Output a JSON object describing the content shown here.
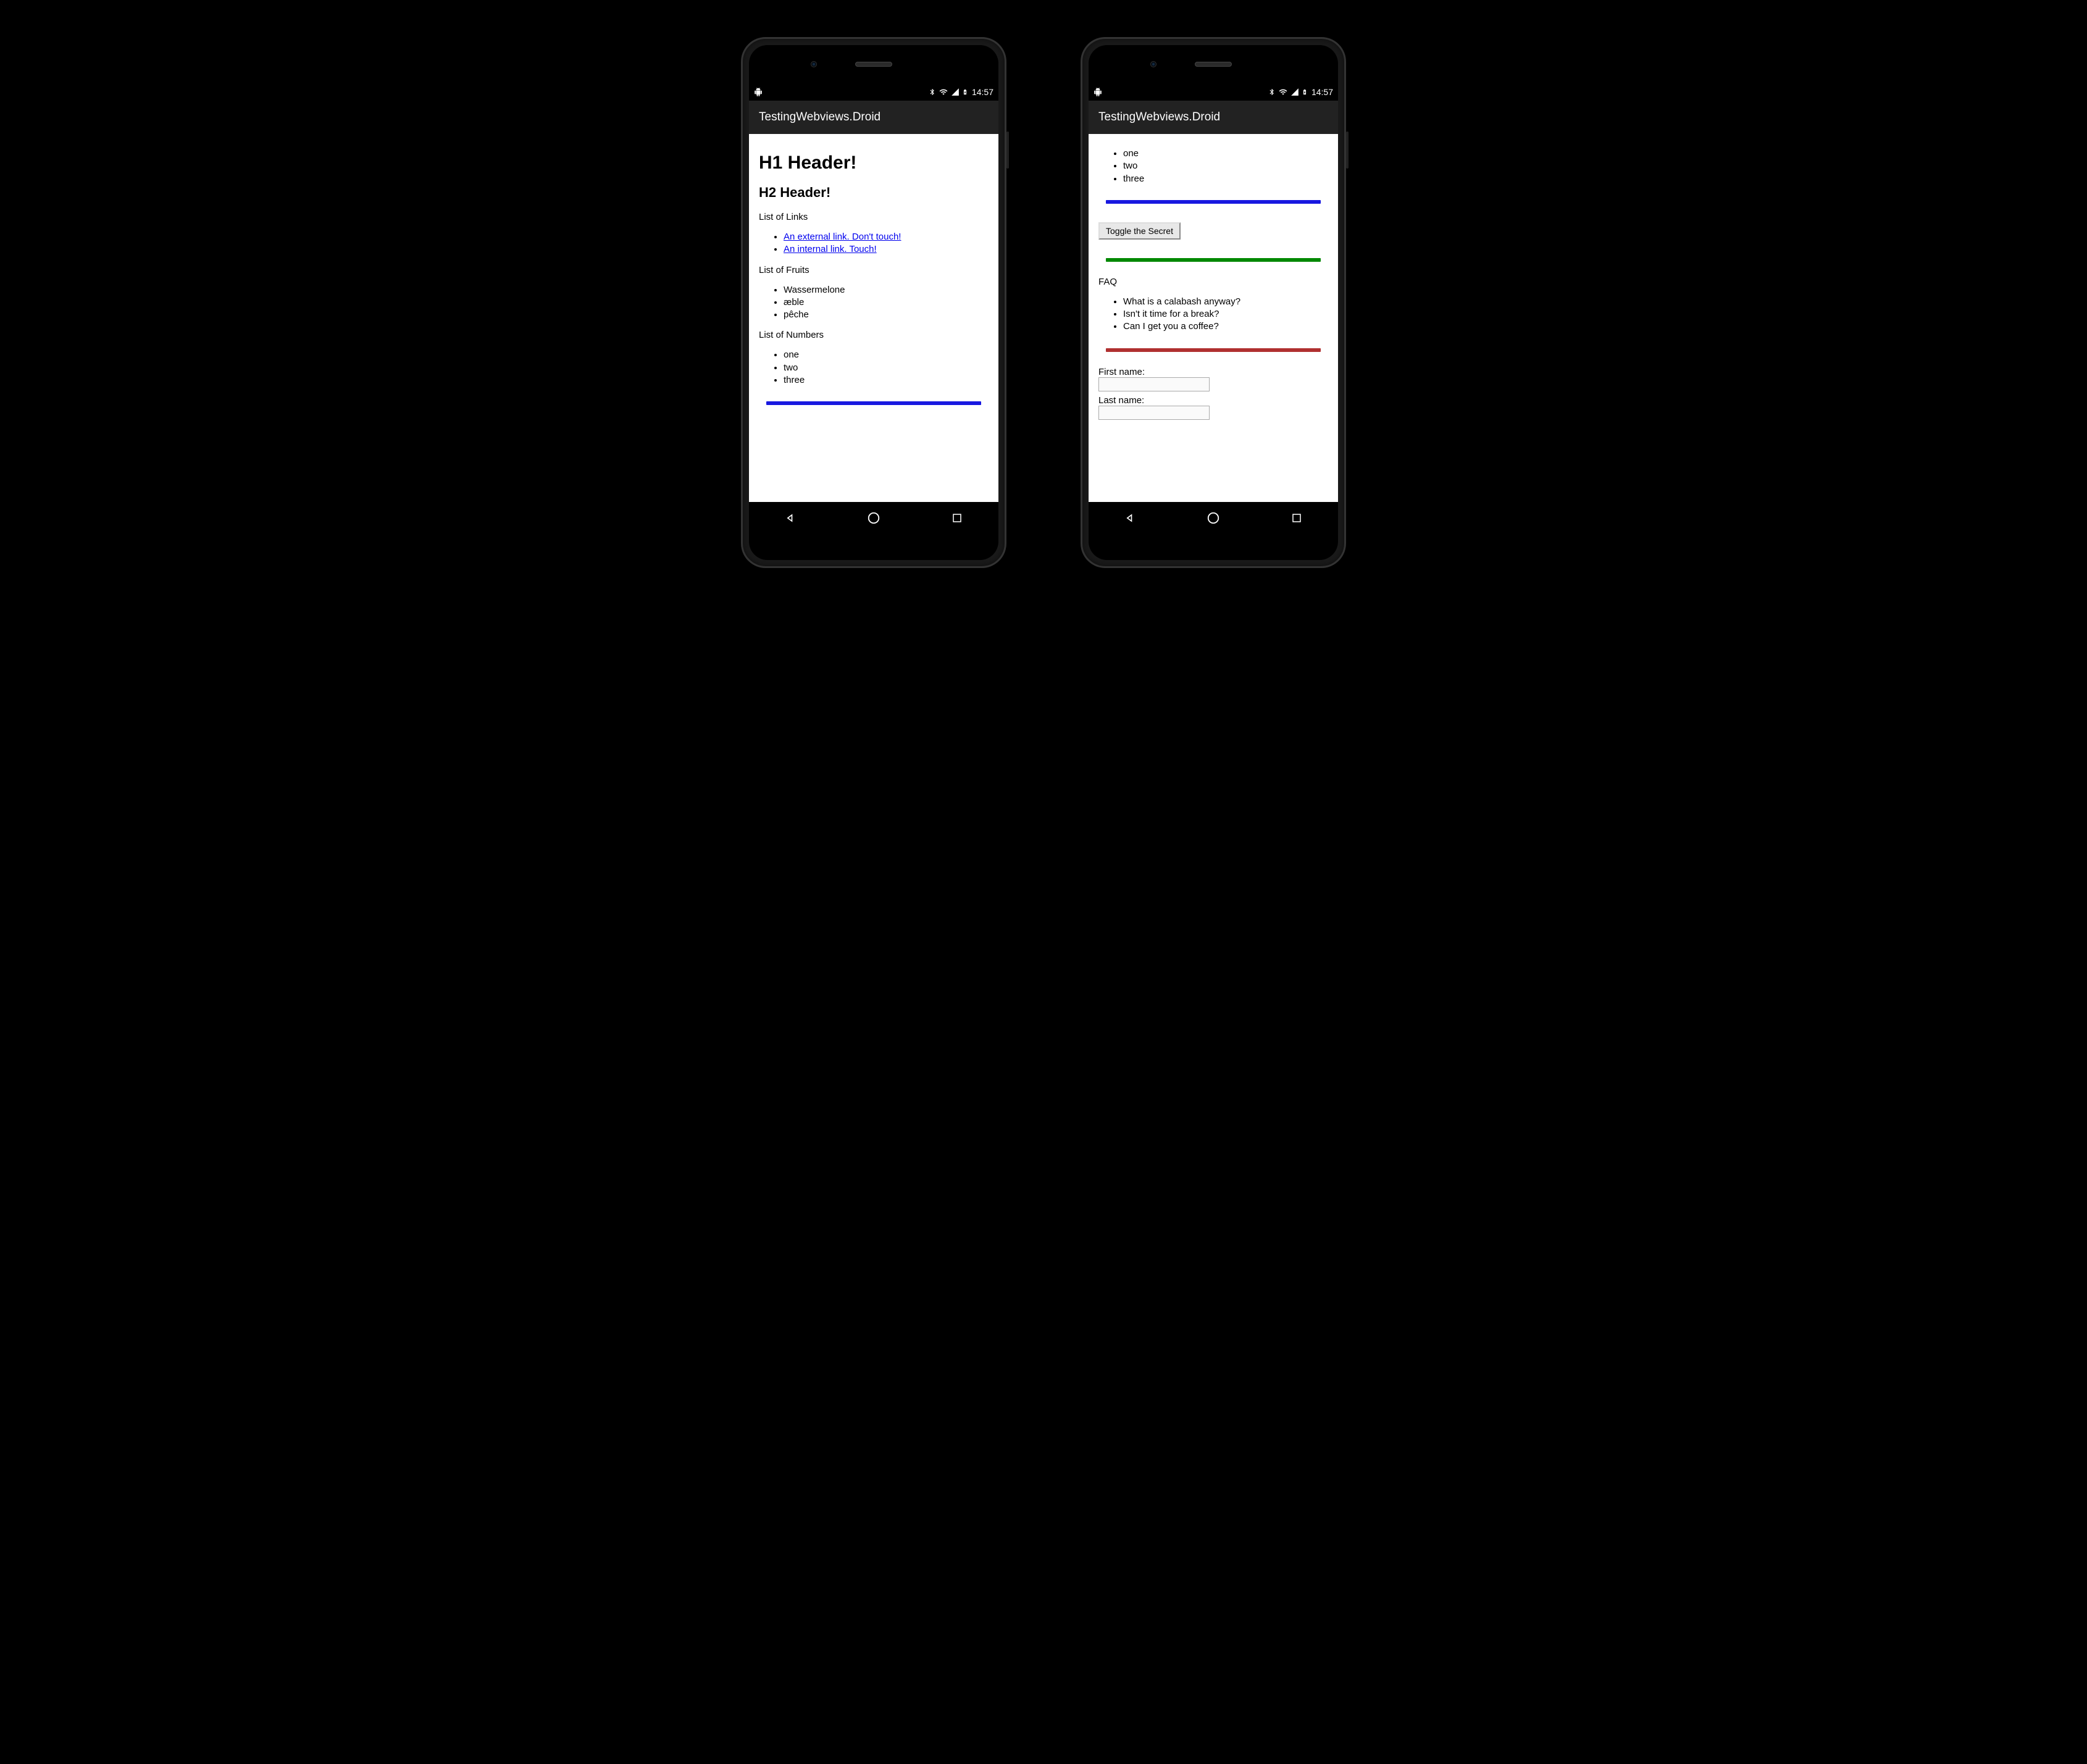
{
  "status_bar": {
    "time": "14:57"
  },
  "app_bar": {
    "title": "TestingWebviews.Droid"
  },
  "phone1": {
    "h1": "H1 Header!",
    "h2": "H2 Header!",
    "links_heading": "List of Links",
    "links": {
      "external": "An external link. Don't touch!",
      "internal": "An internal link. Touch!"
    },
    "fruits_heading": "List of Fruits",
    "fruits": {
      "a": "Wassermelone",
      "b": "æble",
      "c": "pêche"
    },
    "numbers_heading": "List of Numbers",
    "numbers": {
      "a": "one",
      "b": "two",
      "c": "three"
    }
  },
  "phone2": {
    "numbers": {
      "a": "one",
      "b": "two",
      "c": "three"
    },
    "secret_button": "Toggle the Secret",
    "faq_heading": "FAQ",
    "faq": {
      "a": "What is a calabash anyway?",
      "b": "Isn't it time for a break?",
      "c": "Can I get you a coffee?"
    },
    "form": {
      "first_name_label": "First name:",
      "last_name_label": "Last name:"
    }
  }
}
